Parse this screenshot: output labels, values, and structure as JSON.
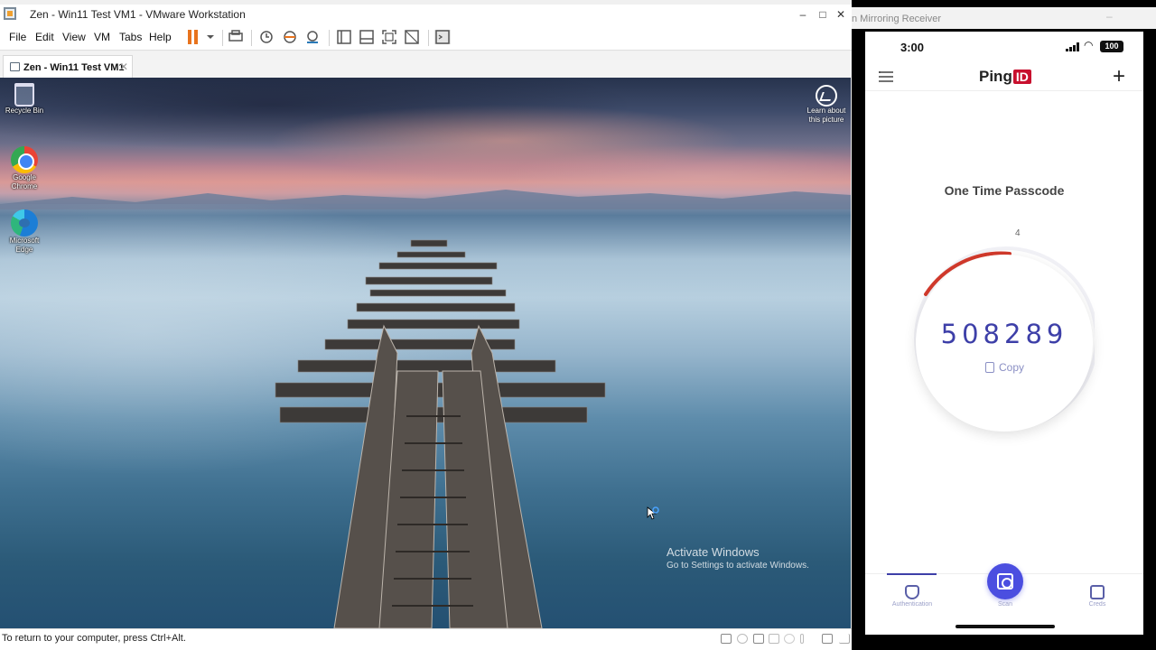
{
  "vmware": {
    "window_title": "Zen - Win11 Test VM1 - VMware Workstation",
    "window_controls": {
      "minimize": "‒",
      "maximize": "□",
      "close": "✕"
    },
    "menu": [
      "File",
      "Edit",
      "View",
      "VM",
      "Tabs",
      "Help"
    ],
    "toolbar_icons": [
      "pause-icon",
      "dropdown-arrow-icon",
      "send-ctrl-alt-del-icon",
      "snapshot-icon",
      "revert-snapshot-icon",
      "snapshot-manager-icon",
      "library-icon",
      "thumbnail-bar-icon",
      "full-screen-icon",
      "unity-icon",
      "console-view-icon"
    ],
    "tab": {
      "label": "Zen - Win11 Test VM1",
      "close": "✕"
    },
    "status_message": "To return to your computer, press Ctrl+Alt.",
    "accent": "#e8731d"
  },
  "desktop": {
    "icons": [
      {
        "name": "recycle-bin-icon",
        "label": "Recycle Bin"
      },
      {
        "name": "google-chrome-icon",
        "label": "Google Chrome"
      },
      {
        "name": "microsoft-edge-icon",
        "label": "Microsoft Edge"
      }
    ],
    "spotlight_label": "Learn about this picture",
    "activate_title": "Activate Windows",
    "activate_sub": "Go to Settings to activate Windows."
  },
  "mirroring": {
    "window_title": "n Mirroring Receiver",
    "minimize": "‒"
  },
  "phone": {
    "time": "3:00",
    "battery": "100",
    "app_logo_text": "Ping",
    "app_logo_badge": "ID",
    "plus": "+",
    "otp_title": "One Time Passcode",
    "otp_code": "508289",
    "timer_value": "4",
    "copy_label": "Copy",
    "nav": {
      "authentication": "Authentication",
      "scan": "Scan",
      "creds": "Creds"
    },
    "accent": "#4b4ee0",
    "timer_color": "#d33a2c"
  }
}
